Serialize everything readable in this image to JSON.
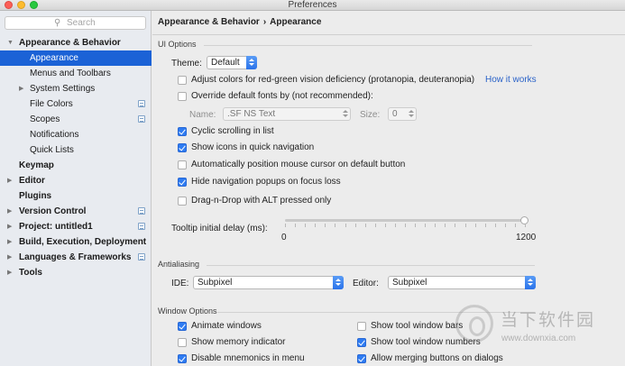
{
  "window": {
    "title": "Preferences"
  },
  "search": {
    "placeholder": "Search"
  },
  "sidebar": {
    "items": [
      {
        "label": "Appearance & Behavior",
        "expanded": true
      },
      {
        "label": "Appearance",
        "selected": true
      },
      {
        "label": "Menus and Toolbars"
      },
      {
        "label": "System Settings",
        "collapsed": true
      },
      {
        "label": "File Colors"
      },
      {
        "label": "Scopes"
      },
      {
        "label": "Notifications"
      },
      {
        "label": "Quick Lists"
      },
      {
        "label": "Keymap"
      },
      {
        "label": "Editor",
        "collapsed": true
      },
      {
        "label": "Plugins"
      },
      {
        "label": "Version Control",
        "collapsed": true
      },
      {
        "label": "Project: untitled1",
        "collapsed": true
      },
      {
        "label": "Build, Execution, Deployment",
        "collapsed": true
      },
      {
        "label": "Languages & Frameworks",
        "collapsed": true
      },
      {
        "label": "Tools",
        "collapsed": true
      }
    ]
  },
  "breadcrumb": {
    "parent": "Appearance & Behavior",
    "separator": "›",
    "current": "Appearance"
  },
  "ui_options": {
    "section_title": "UI Options",
    "theme_label": "Theme:",
    "theme_value": "Default",
    "adjust_colors": {
      "label": "Adjust colors for red-green vision deficiency (protanopia, deuteranopia)",
      "checked": false
    },
    "how_it_works_link": "How it works",
    "override_fonts": {
      "label": "Override default fonts by (not recommended):",
      "checked": false
    },
    "font_name_label": "Name:",
    "font_name_value": ".SF NS Text",
    "font_size_label": "Size:",
    "font_size_value": "0",
    "cyclic_scrolling": {
      "label": "Cyclic scrolling in list",
      "checked": true
    },
    "show_icons": {
      "label": "Show icons in quick navigation",
      "checked": true
    },
    "auto_position_mouse": {
      "label": "Automatically position mouse cursor on default button",
      "checked": false
    },
    "hide_nav_popups": {
      "label": "Hide navigation popups on focus loss",
      "checked": true
    },
    "drag_n_drop": {
      "label": "Drag-n-Drop with ALT pressed only",
      "checked": false
    },
    "tooltip_label": "Tooltip initial delay (ms):",
    "tooltip_min": "0",
    "tooltip_max": "1200",
    "tooltip_value": 1200
  },
  "antialiasing": {
    "section_title": "Antialiasing",
    "ide_label": "IDE:",
    "ide_value": "Subpixel",
    "editor_label": "Editor:",
    "editor_value": "Subpixel"
  },
  "window_options": {
    "section_title": "Window Options",
    "animate_windows": {
      "label": "Animate windows",
      "checked": true
    },
    "show_memory": {
      "label": "Show memory indicator",
      "checked": false
    },
    "disable_mnemonics": {
      "label": "Disable mnemonics in menu",
      "checked": true
    },
    "show_tool_window_bars": {
      "label": "Show tool window bars",
      "checked": false
    },
    "show_tool_window_numbers": {
      "label": "Show tool window numbers",
      "checked": true
    },
    "allow_merging_buttons": {
      "label": "Allow merging buttons on dialogs",
      "checked": true
    }
  },
  "watermark": {
    "text": "当下软件园",
    "url": "www.downxia.com"
  },
  "colors": {
    "selection": "#1b62d6",
    "checkbox": "#2f7cf2",
    "link": "#2a62c8"
  }
}
